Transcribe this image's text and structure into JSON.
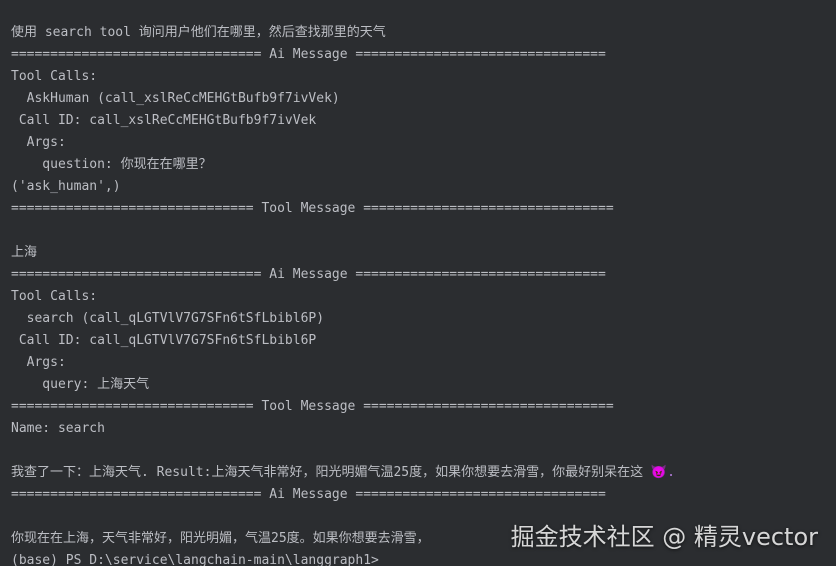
{
  "terminal": {
    "lines": [
      "使用 search tool 询问用户他们在哪里，然后查找那里的天气",
      "================================ Ai Message ================================",
      "Tool Calls:",
      "  AskHuman (call_xslReCcMEHGtBufb9f7ivVek)",
      " Call ID: call_xslReCcMEHGtBufb9f7ivVek",
      "  Args:",
      "    question: 你现在在哪里？",
      "('ask_human',)",
      "=============================== Tool Message ================================",
      "",
      "上海",
      "================================ Ai Message ================================",
      "Tool Calls:",
      "  search (call_qLGTVlV7G7SFn6tSfLbibl6P)",
      " Call ID: call_qLGTVlV7G7SFn6tSfLbibl6P",
      "  Args:",
      "    query: 上海天气",
      "=============================== Tool Message ================================",
      "Name: search",
      "",
      "我查了一下：上海天气. Result:上海天气非常好，阳光明媚气温25度，如果你想要去滑雪，你最好别呆在这 ",
      "================================ Ai Message ================================",
      "",
      "你现在在上海，天气非常好，阳光明媚，气温25度。如果你想要去滑雪，",
      "(base) PS D:\\service\\langchain-main\\langgraph1>"
    ],
    "emoji": "😈."
  },
  "watermark": "掘金技术社区 @ 精灵vector"
}
